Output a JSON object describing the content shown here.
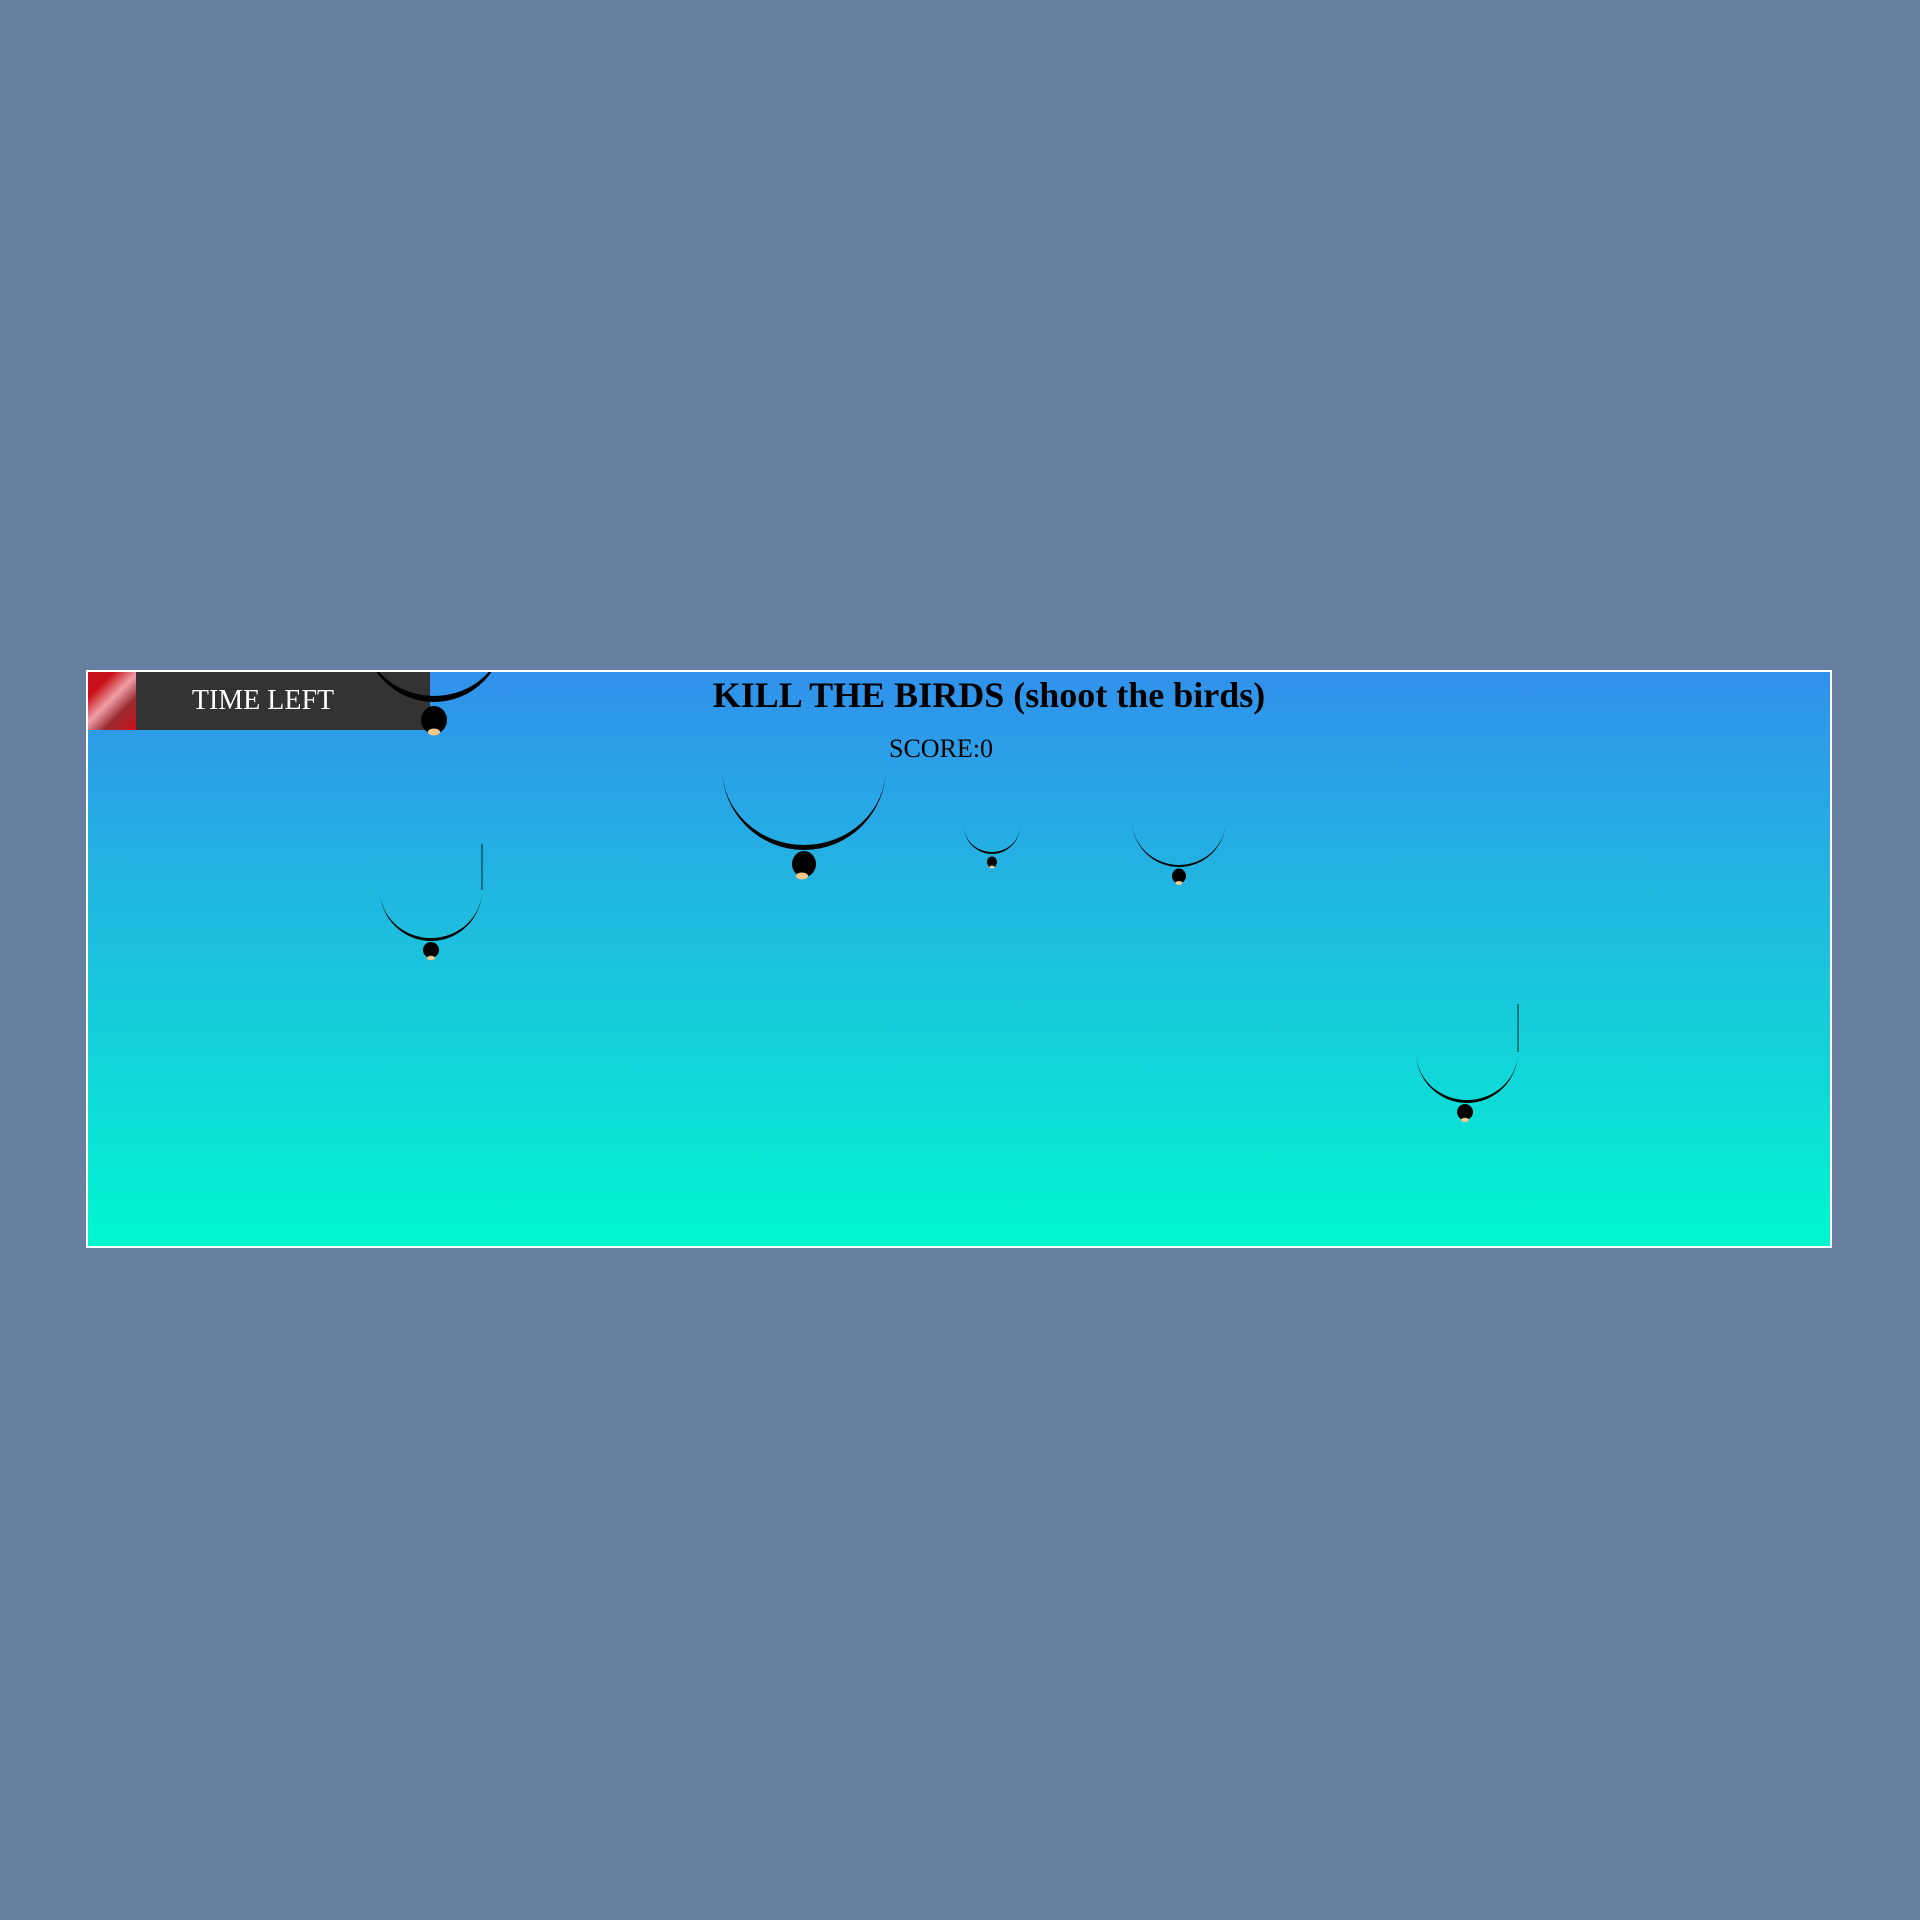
{
  "game": {
    "title": "KILL THE BIRDS (shoot the birds)",
    "score_text": "SCORE:0",
    "timer": {
      "label": "TIME LEFT",
      "remaining_fraction": 0.14
    }
  },
  "colors": {
    "page_background": "#67809f",
    "sky_top": "#3191ec",
    "sky_bottom": "#00f8d0",
    "timer_background": "#333333",
    "timer_fill": "#c8101a",
    "bird_body": "#000000",
    "bird_beak": "#f5c88a"
  },
  "birds": [
    {
      "name": "bird-1"
    },
    {
      "name": "bird-2"
    },
    {
      "name": "bird-3"
    },
    {
      "name": "bird-4"
    },
    {
      "name": "bird-5"
    },
    {
      "name": "bird-6"
    }
  ]
}
